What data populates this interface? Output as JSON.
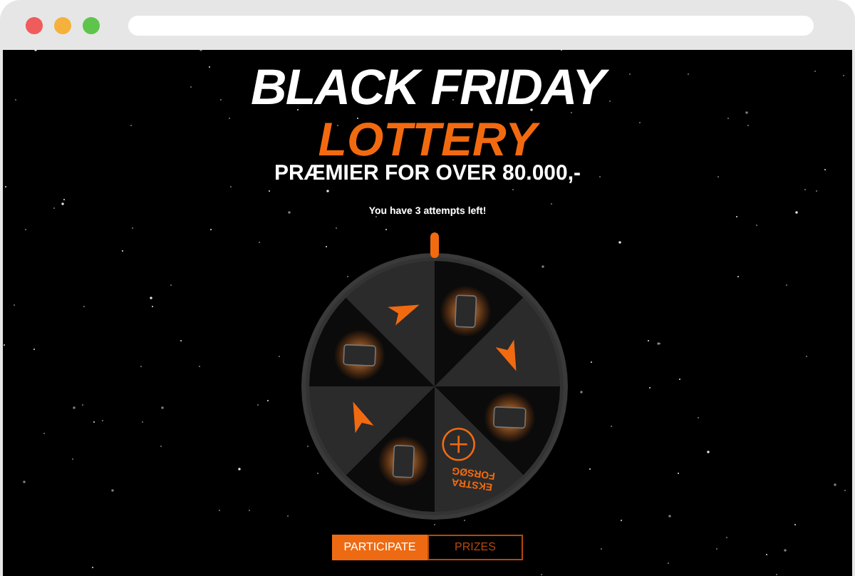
{
  "header": {
    "title": "BLACK FRIDAY",
    "subtitle": "LOTTERY",
    "tagline": "PRÆMIER FOR OVER 80.000,-"
  },
  "attempts_text": "You have 3 attempts left!",
  "wheel": {
    "segments": [
      {
        "kind": "prize"
      },
      {
        "kind": "arrow"
      },
      {
        "kind": "prize"
      },
      {
        "kind": "extra",
        "lines": [
          "EKSTRA",
          "FORSØG"
        ]
      },
      {
        "kind": "prize"
      },
      {
        "kind": "arrow"
      },
      {
        "kind": "prize"
      },
      {
        "kind": "arrow"
      }
    ]
  },
  "tabs": [
    {
      "label": "PARTICIPATE",
      "selected": true
    },
    {
      "label": "PRIZES",
      "selected": false
    }
  ]
}
